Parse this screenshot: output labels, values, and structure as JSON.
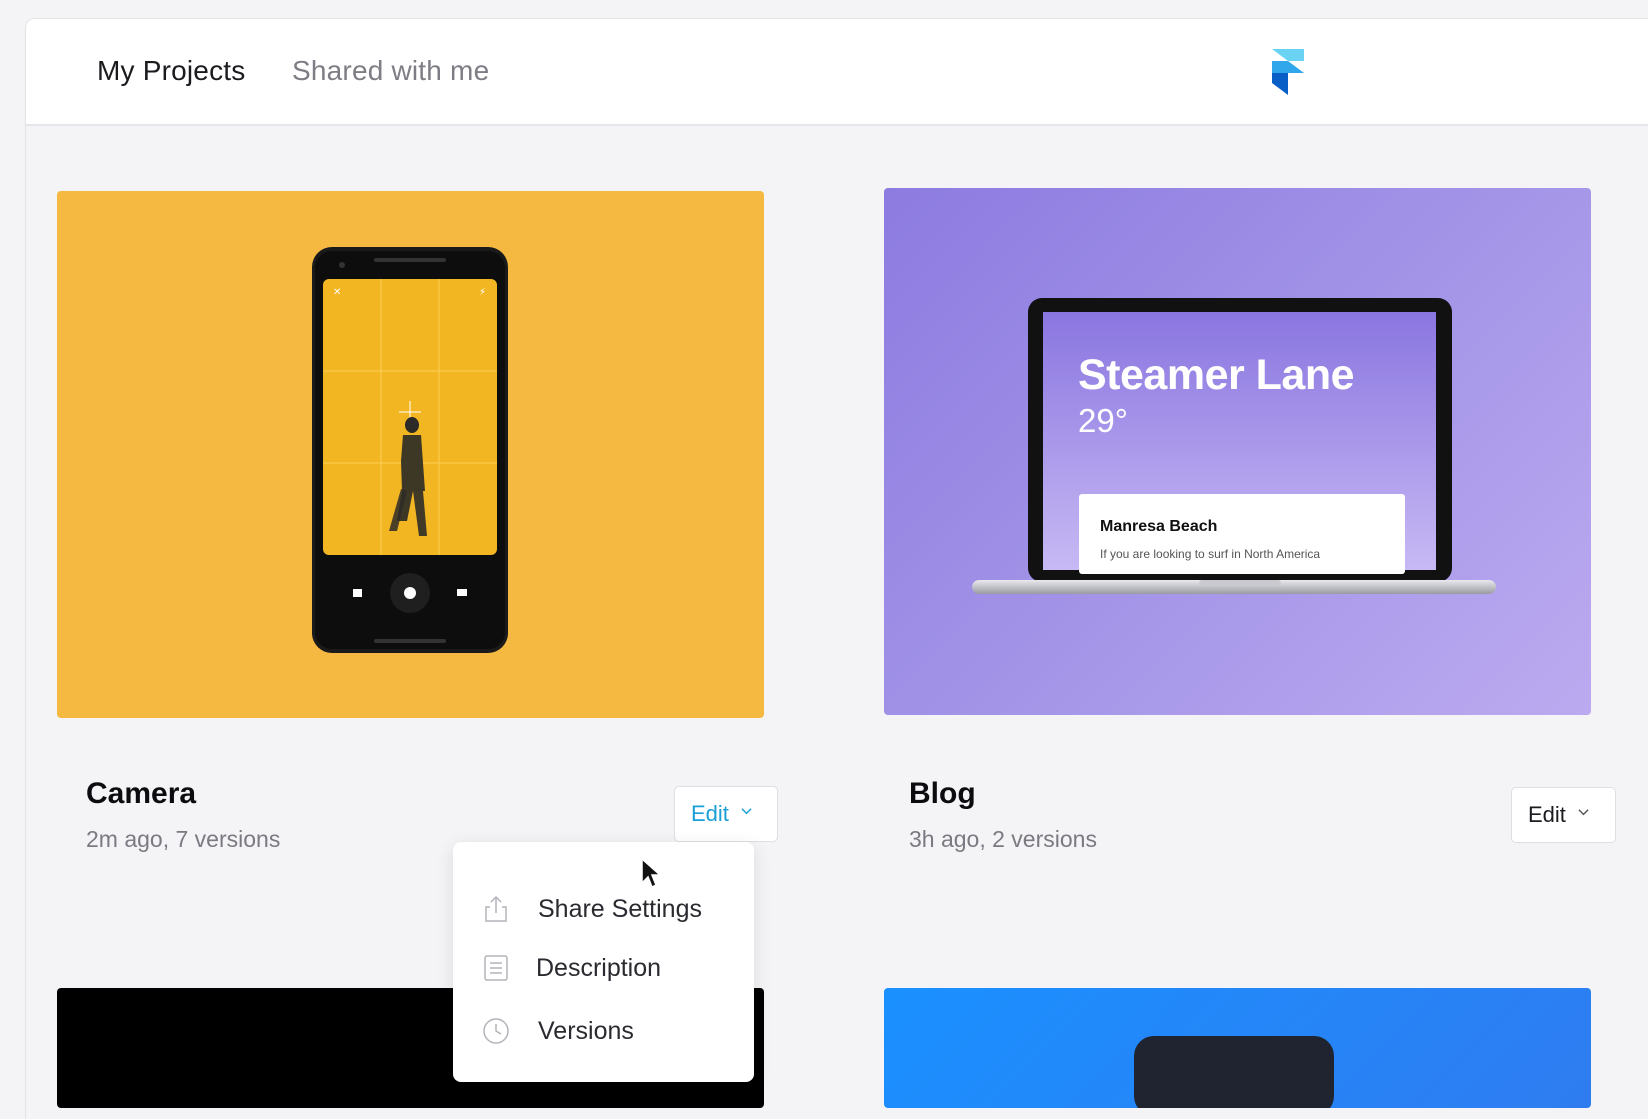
{
  "header": {
    "tabs": [
      {
        "label": "My Projects",
        "active": true
      },
      {
        "label": "Shared with me",
        "active": false
      }
    ],
    "logo_icon": "framer-logo-icon"
  },
  "projects": [
    {
      "title": "Camera",
      "meta": "2m ago, 7 versions",
      "edit_label": "Edit",
      "thumbnail_color": "#f5b942",
      "dropdown_open": true
    },
    {
      "title": "Blog",
      "meta": "3h ago, 2 versions",
      "edit_label": "Edit",
      "thumbnail_color": "#9b8ae4",
      "preview": {
        "heading": "Steamer Lane",
        "temperature": "29°",
        "card_title": "Manresa Beach",
        "card_text": "If you are looking to surf in North America"
      }
    }
  ],
  "dropdown": {
    "items": [
      {
        "label": "Share Settings",
        "icon": "share-icon"
      },
      {
        "label": "Description",
        "icon": "document-icon"
      },
      {
        "label": "Versions",
        "icon": "clock-icon"
      }
    ]
  },
  "colors": {
    "accent": "#1a9fd6",
    "background": "#f4f3f5",
    "camera_bg": "#f5b942",
    "blog_bg": "#9b8ae4"
  }
}
